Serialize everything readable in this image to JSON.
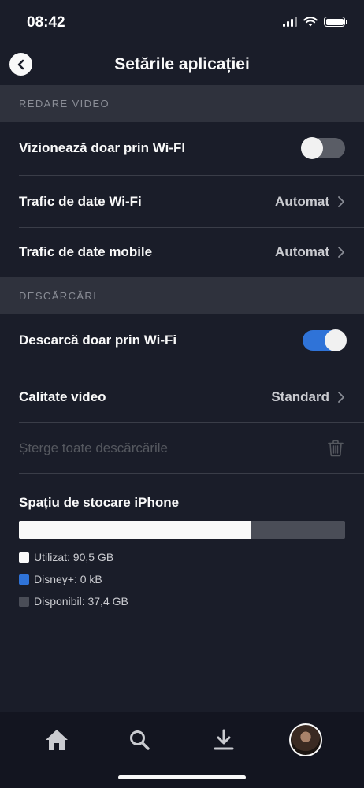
{
  "status_bar": {
    "time": "08:42"
  },
  "header": {
    "title": "Setările aplicației"
  },
  "sections": {
    "video_playback": {
      "title": "REDARE VIDEO",
      "wifi_only_label": "Vizionează doar prin Wi-FI",
      "wifi_only_enabled": false,
      "wifi_data_label": "Trafic de date Wi-Fi",
      "wifi_data_value": "Automat",
      "mobile_data_label": "Trafic de date mobile",
      "mobile_data_value": "Automat"
    },
    "downloads": {
      "title": "DESCĂRCĂRI",
      "download_wifi_label": "Descarcă doar prin Wi-Fi",
      "download_wifi_enabled": true,
      "video_quality_label": "Calitate video",
      "video_quality_value": "Standard",
      "delete_all_label": "Șterge toate descărcările"
    }
  },
  "storage": {
    "title": "Spațiu de stocare iPhone",
    "used_fraction": 0.71,
    "legend": {
      "used": "Utilizat: 90,5 GB",
      "disney": "Disney+: 0 kB",
      "available": "Disponibil: 37,4 GB"
    },
    "colors": {
      "used": "#f9f9f9",
      "disney": "#2f73d8",
      "available": "#4a4d57"
    }
  },
  "tab_bar": {
    "items": [
      {
        "icon": "home-icon"
      },
      {
        "icon": "search-icon"
      },
      {
        "icon": "download-icon"
      },
      {
        "icon": "profile-avatar"
      }
    ]
  }
}
